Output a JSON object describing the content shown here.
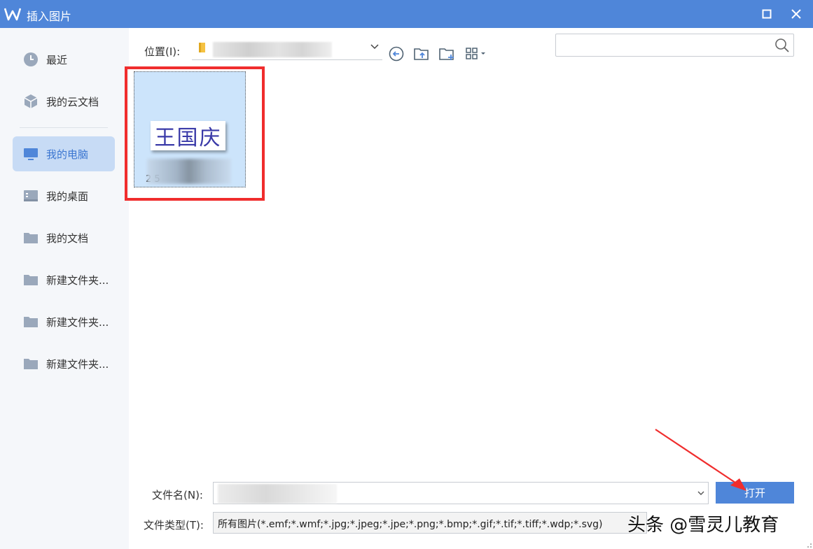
{
  "window": {
    "title": "插入图片",
    "accent_color": "#4f86d9",
    "highlight_color": "#f02d2d"
  },
  "sidebar": {
    "items": [
      {
        "label": "最近",
        "icon": "clock-icon",
        "active": false
      },
      {
        "label": "我的云文档",
        "icon": "cloud-cube-icon",
        "active": false
      },
      {
        "label": "我的电脑",
        "icon": "monitor-icon",
        "active": true
      },
      {
        "label": "我的桌面",
        "icon": "desktop-icon",
        "active": false
      },
      {
        "label": "我的文档",
        "icon": "folder-icon",
        "active": false
      },
      {
        "label": "新建文件夹...",
        "icon": "folder-icon",
        "active": false
      },
      {
        "label": "新建文件夹...",
        "icon": "folder-icon",
        "active": false
      },
      {
        "label": "新建文件夹...",
        "icon": "folder-icon",
        "active": false
      }
    ]
  },
  "toolbar": {
    "location_label": "位置(I):",
    "search_placeholder": ""
  },
  "file": {
    "thumbnail_text": "王国庆",
    "name_visible": "2               5"
  },
  "bottom": {
    "filename_label": "文件名(N):",
    "filetype_label": "文件类型(T):",
    "filetype_value": "所有图片(*.emf;*.wmf;*.jpg;*.jpeg;*.jpe;*.png;*.bmp;*.gif;*.tif;*.tiff;*.wdp;*.svg)",
    "open_label": "打开"
  },
  "watermark": "头条 @雪灵儿教育"
}
